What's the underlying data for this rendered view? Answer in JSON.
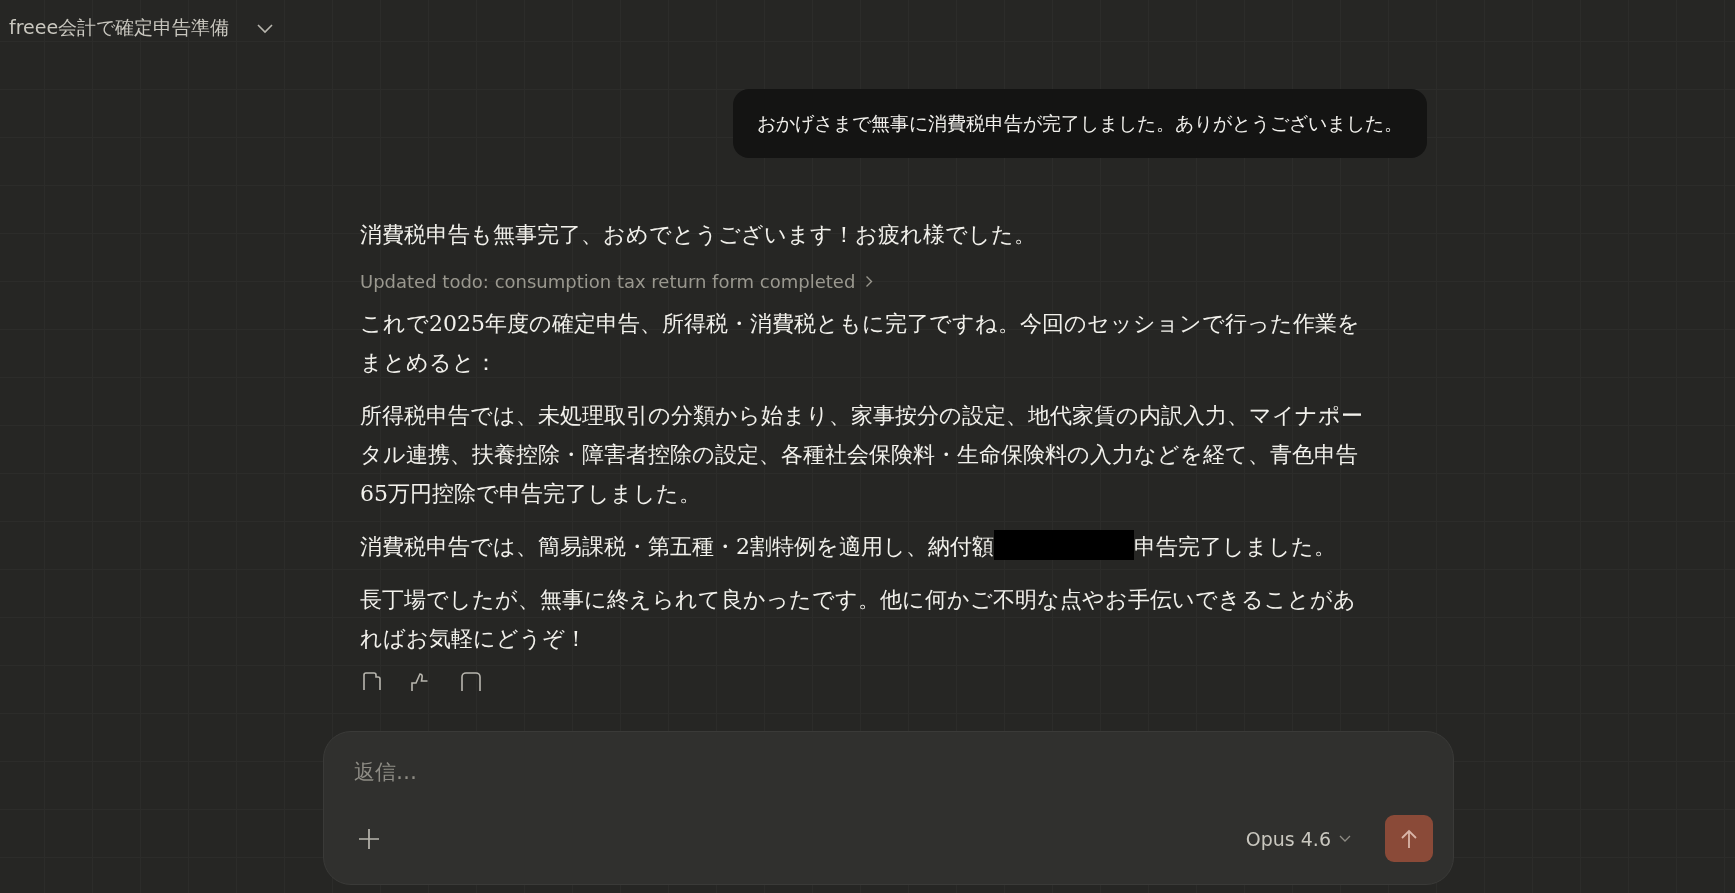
{
  "header": {
    "title": "freee会計で確定申告準備"
  },
  "user_message": {
    "text": "おかげさまで無事に消費税申告が完了しました。ありがとうございました。"
  },
  "assistant": {
    "intro": "消費税申告も無事完了、おめでとうございます！お疲れ様でした。",
    "tool_update": "Updated todo: consumption tax return form completed",
    "paragraphs": [
      {
        "segments": [
          {
            "kind": "text",
            "text": "これで2025年度の確定申告、所得税・消費税ともに完了ですね。今回のセッションで行った作業をまとめると："
          }
        ]
      },
      {
        "segments": [
          {
            "kind": "text",
            "text": "所得税申告では、未処理取引の分類から始まり、家事按分の設定、地代家賃の内訳入力、マイナポータル連携、扶養控除・障害者控除の設定、各種社会保険料・生命保険料の入力などを経て、青色申告65万円控除で申告完了しました。"
          }
        ]
      },
      {
        "segments": [
          {
            "kind": "text",
            "text": "消費税申告では、簡易課税・第五種・2割特例を適用し、納付額"
          },
          {
            "kind": "redacted"
          },
          {
            "kind": "text",
            "text": "申告完了しました。"
          }
        ]
      },
      {
        "segments": [
          {
            "kind": "text",
            "text": "長丁場でしたが、無事に終えられて良かったです。他に何かご不明な点やお手伝いできることがあればお気軽にどうぞ！"
          }
        ]
      }
    ]
  },
  "composer": {
    "placeholder": "返信…",
    "model": "Opus 4.6"
  }
}
